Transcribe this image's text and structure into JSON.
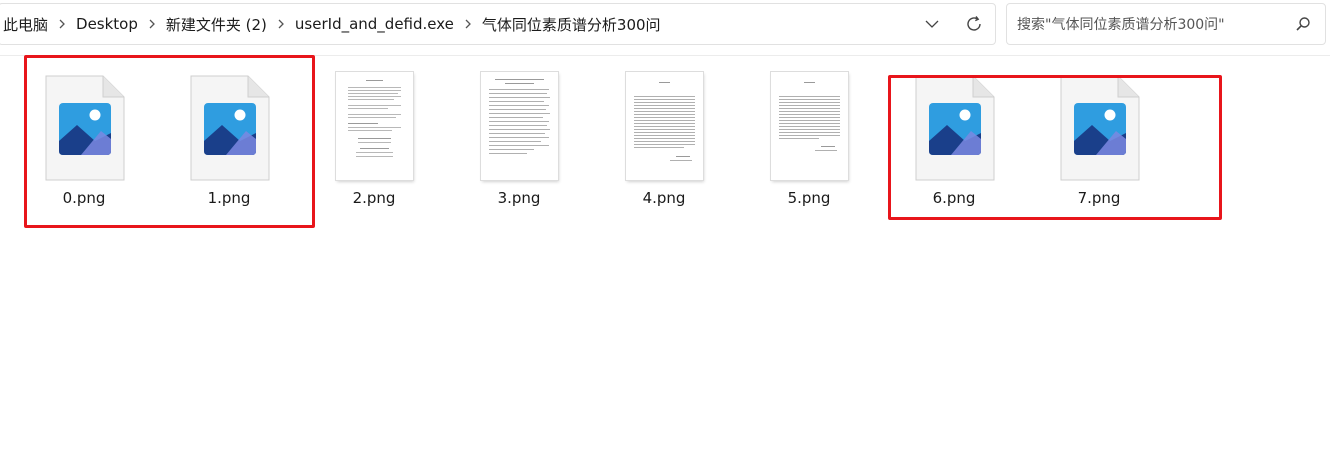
{
  "breadcrumb": {
    "items": [
      "此电脑",
      "Desktop",
      "新建文件夹 (2)",
      "userId_and_defid.exe",
      "气体同位素质谱分析300问"
    ]
  },
  "search": {
    "placeholder": "搜索\"气体同位素质谱分析300问\""
  },
  "files": [
    {
      "name": "0.png",
      "kind": "generic-image"
    },
    {
      "name": "1.png",
      "kind": "generic-image"
    },
    {
      "name": "2.png",
      "kind": "document-thumbnail"
    },
    {
      "name": "3.png",
      "kind": "document-thumbnail"
    },
    {
      "name": "4.png",
      "kind": "document-thumbnail"
    },
    {
      "name": "5.png",
      "kind": "document-thumbnail"
    },
    {
      "name": "6.png",
      "kind": "generic-image"
    },
    {
      "name": "7.png",
      "kind": "generic-image"
    }
  ],
  "annotations": {
    "highlight_color": "#e8151b",
    "highlighted_files": [
      [
        "0.png",
        "1.png"
      ],
      [
        "6.png",
        "7.png"
      ]
    ]
  },
  "icons": {
    "breadcrumb_separator": "chevron-right-icon",
    "dropdown": "chevron-down-icon",
    "refresh": "refresh-icon",
    "search": "search-icon",
    "image_file": "image-file-icon"
  }
}
